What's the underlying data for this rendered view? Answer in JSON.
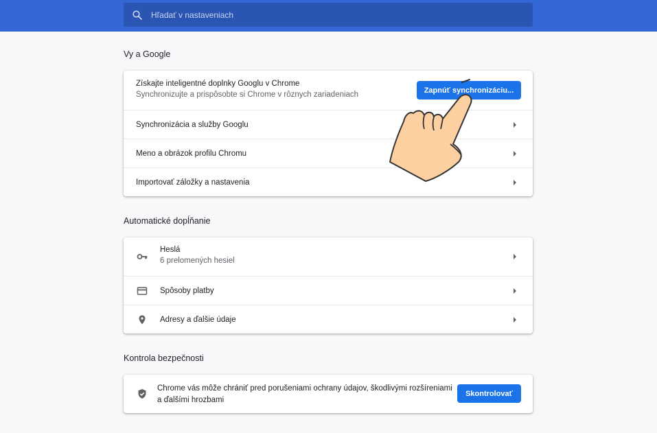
{
  "search": {
    "placeholder": "Hľadať v nastaveniach"
  },
  "sections": {
    "you_and_google": {
      "title": "Vy a Google",
      "sync_promo": {
        "title": "Získajte inteligentné doplnky Googlu v Chrome",
        "subtitle": "Synchronizujte a prispôsobte si Chrome v rôznych zariadeniach",
        "button": "Zapnúť synchronizáciu..."
      },
      "items": [
        {
          "label": "Synchronizácia a služby Googlu"
        },
        {
          "label": "Meno a obrázok profilu Chromu"
        },
        {
          "label": "Importovať záložky a nastavenia"
        }
      ]
    },
    "autofill": {
      "title": "Automatické dopĺňanie",
      "items": [
        {
          "label": "Heslá",
          "sub": "6 prelomených hesiel",
          "icon": "key-icon"
        },
        {
          "label": "Spôsoby platby",
          "icon": "credit-card-icon"
        },
        {
          "label": "Adresy a ďalšie údaje",
          "icon": "location-pin-icon"
        }
      ]
    },
    "safety": {
      "title": "Kontrola bezpečnosti",
      "text_line1": "Chrome vás môže chrániť pred porušeniami ochrany údajov, škodlivými rozšíreniami",
      "text_line2": "a ďalšími hrozbami",
      "button": "Skontrolovať",
      "icon": "shield-check-icon"
    }
  },
  "colors": {
    "header": "#3367d6",
    "search_bg": "#2a55b3",
    "accent_button": "#1a73e8",
    "page_bg": "#f7f8fa"
  },
  "overlay": {
    "icon": "pointing-hand-cursor-icon"
  }
}
